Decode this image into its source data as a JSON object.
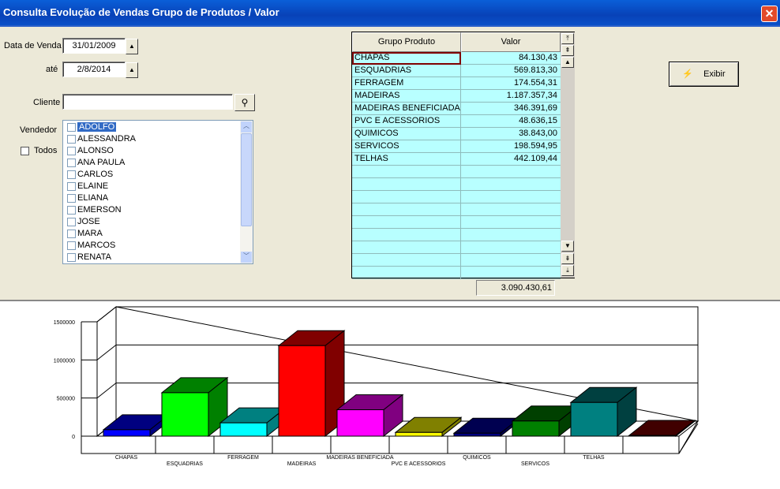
{
  "window": {
    "title": "Consulta Evolução de Vendas Grupo de Produtos / Valor",
    "close_icon": "close-icon"
  },
  "filters": {
    "data_venda_label": "Data de Venda",
    "data_venda_value": "31/01/2009",
    "ate_label": "até",
    "ate_value": "2/8/2014",
    "cliente_label": "Cliente",
    "cliente_value": "",
    "vendedor_label": "Vendedor",
    "todos_label": "Todos",
    "vendedores": [
      "ADOLFO",
      "ALESSANDRA",
      "ALONSO",
      "ANA PAULA",
      "CARLOS",
      "ELAINE",
      "ELIANA",
      "EMERSON",
      "JOSE",
      "MARA",
      "MARCOS",
      "RENATA"
    ],
    "selected_vendedor": "ADOLFO"
  },
  "grid": {
    "headers": [
      "Grupo Produto",
      "Valor"
    ],
    "rows": [
      [
        "CHAPAS",
        "84.130,43"
      ],
      [
        "ESQUADRIAS",
        "569.813,30"
      ],
      [
        "FERRAGEM",
        "174.554,31"
      ],
      [
        "MADEIRAS",
        "1.187.357,34"
      ],
      [
        "MADEIRAS BENEFICIADA",
        "346.391,69"
      ],
      [
        "PVC E ACESSORIOS",
        "48.636,15"
      ],
      [
        "QUIMICOS",
        "38.843,00"
      ],
      [
        "SERVICOS",
        "198.594,95"
      ],
      [
        "TELHAS",
        "442.109,44"
      ]
    ],
    "total": "3.090.430,61"
  },
  "exibir_label": "Exibir",
  "chart_data": {
    "type": "bar",
    "categories": [
      "CHAPAS",
      "ESQUADRIAS",
      "FERRAGEM",
      "MADEIRAS",
      "MADEIRAS BENEFICIADA",
      "PVC E ACESSORIOS",
      "QUIMICOS",
      "SERVICOS",
      "TELHAS",
      ""
    ],
    "values": [
      84130.43,
      569813.3,
      174554.31,
      1187357.34,
      346391.69,
      48636.15,
      38843.0,
      198594.95,
      442109.44,
      0
    ],
    "colors": [
      [
        "#0000ff",
        "#000080"
      ],
      [
        "#00ff00",
        "#008000"
      ],
      [
        "#00ffff",
        "#008080"
      ],
      [
        "#ff0000",
        "#800000"
      ],
      [
        "#ff00ff",
        "#800080"
      ],
      [
        "#ffff00",
        "#808000"
      ],
      [
        "#000080",
        "#000050"
      ],
      [
        "#008000",
        "#004000"
      ],
      [
        "#008080",
        "#004040"
      ],
      [
        "#800000",
        "#400000"
      ]
    ],
    "yticks": [
      "0",
      "500000",
      "1000000",
      "1500000"
    ],
    "ylim": [
      0,
      1500000
    ],
    "grid": true,
    "3d": true
  }
}
